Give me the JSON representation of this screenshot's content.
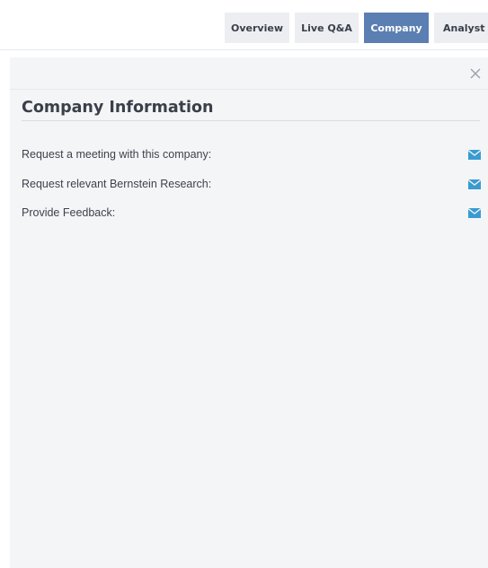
{
  "nav": {
    "tabs": [
      {
        "label": "Overview"
      },
      {
        "label": "Live Q&A"
      },
      {
        "label": "Company",
        "active": true
      },
      {
        "label": "Analyst"
      }
    ]
  },
  "panel": {
    "title": "Company Information",
    "close_icon": "close-icon",
    "rows": [
      {
        "label": "Request a meeting with this company:",
        "icon": "mail-icon"
      },
      {
        "label": "Request relevant Bernstein Research:",
        "icon": "mail-icon"
      },
      {
        "label": "Provide Feedback:",
        "icon": "mail-icon"
      }
    ]
  },
  "colors": {
    "accent": "#5b7fb2",
    "mail_icon": "#3a9bd0",
    "panel_bg": "#f4f5f7"
  }
}
